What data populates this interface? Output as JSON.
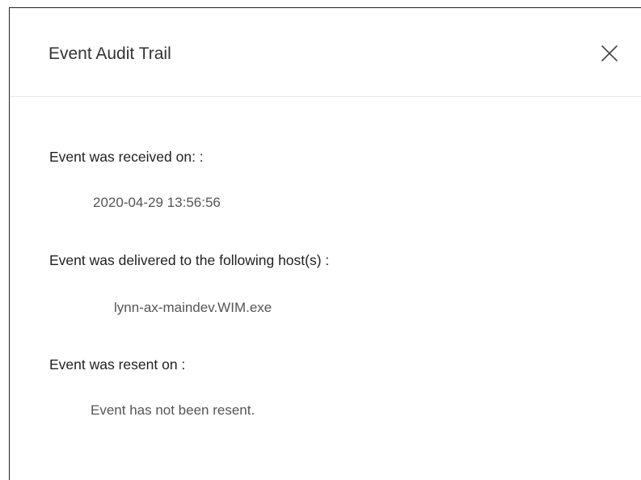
{
  "dialog": {
    "title": "Event Audit Trail",
    "close_label": "X"
  },
  "sections": [
    {
      "label": "Event was received on: :",
      "value": "2020-04-29 13:56:56"
    },
    {
      "label": "Event was delivered to the following host(s) :",
      "value": "lynn-ax-maindev.WIM.exe"
    },
    {
      "label": "Event was resent on :",
      "value": "Event has not been resent."
    }
  ]
}
